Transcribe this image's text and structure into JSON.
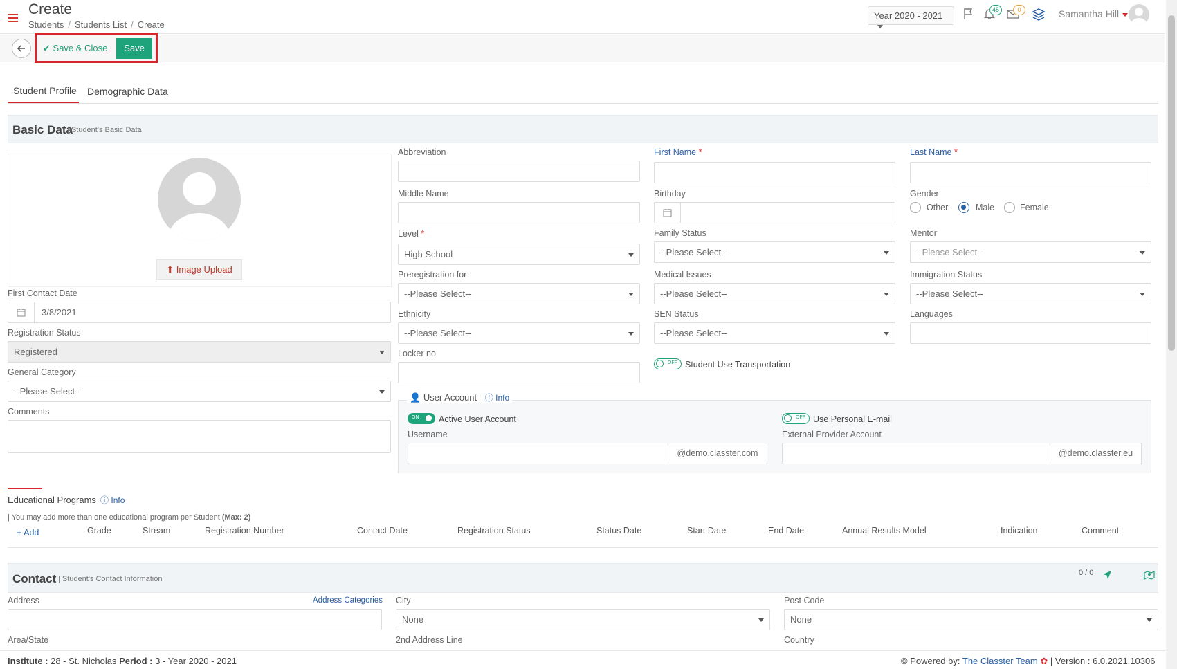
{
  "header": {
    "title": "Create",
    "breadcrumbs": [
      "Students",
      "Students List",
      "Create"
    ],
    "year": "Year 2020 - 2021",
    "notifications_count": "45",
    "messages_count": "0",
    "user_name": "Samantha Hill"
  },
  "toolbar": {
    "save_close_label": "Save & Close",
    "save_label": "Save"
  },
  "tabs": [
    "Student Profile",
    "Demographic Data"
  ],
  "basic": {
    "title": "Basic Data",
    "subtitle": "| Student's Basic Data",
    "image_upload": "Image Upload",
    "first_contact_label": "First Contact Date",
    "first_contact_value": "3/8/2021",
    "reg_status_label": "Registration Status",
    "reg_status_value": "Registered",
    "gen_cat_label": "General Category",
    "gen_cat_value": "--Please Select--",
    "comments_label": "Comments",
    "abbreviation": "Abbreviation",
    "first_name": "First Name",
    "last_name": "Last Name",
    "middle_name": "Middle Name",
    "birthday": "Birthday",
    "gender": "Gender",
    "gender_options": [
      "Other",
      "Male",
      "Female"
    ],
    "level": "Level",
    "level_value": "High School",
    "family_status": "Family Status",
    "mentor": "Mentor",
    "prereg": "Preregistration for",
    "medical": "Medical Issues",
    "immigration": "Immigration Status",
    "ethnicity": "Ethnicity",
    "sen": "SEN Status",
    "languages": "Languages",
    "locker": "Locker no",
    "transport": "Student Use Transportation",
    "please_select": "--Please Select--",
    "star": "*",
    "off": "OFF",
    "on": "ON"
  },
  "account": {
    "title": "User Account",
    "info": "Info",
    "active": "Active User Account",
    "personal_email": "Use Personal E-mail",
    "username": "Username",
    "username_suffix": "@demo.classter.com",
    "external": "External Provider Account",
    "external_suffix": "@demo.classter.eu"
  },
  "programs": {
    "title": "Educational Programs",
    "info": "Info",
    "note": "| You may add more than one educational program per Student ",
    "max": "(Max: 2)",
    "add": "Add",
    "columns": [
      "Grade",
      "Stream",
      "Registration Number",
      "Contact Date",
      "Registration Status",
      "Status Date",
      "Start Date",
      "End Date",
      "Annual Results Model",
      "Indication",
      "Comment"
    ]
  },
  "contact": {
    "title": "Contact",
    "subtitle": "| Student's Contact Information",
    "counter": "0 / 0",
    "address": "Address",
    "address_categories": "Address Categories",
    "city": "City",
    "city_value": "None",
    "post_code": "Post Code",
    "post_code_value": "None",
    "area": "Area/State",
    "address2": "2nd Address Line",
    "country": "Country"
  },
  "footer": {
    "institute_label": "Institute :",
    "institute_value": " 28 - St. Nicholas ",
    "period_label": "Period :",
    "period_value": " 3 - Year 2020 - 2021",
    "powered": "Powered by:",
    "team": "The Classter Team",
    "version": "| Version : 6.0.2021.10306"
  }
}
